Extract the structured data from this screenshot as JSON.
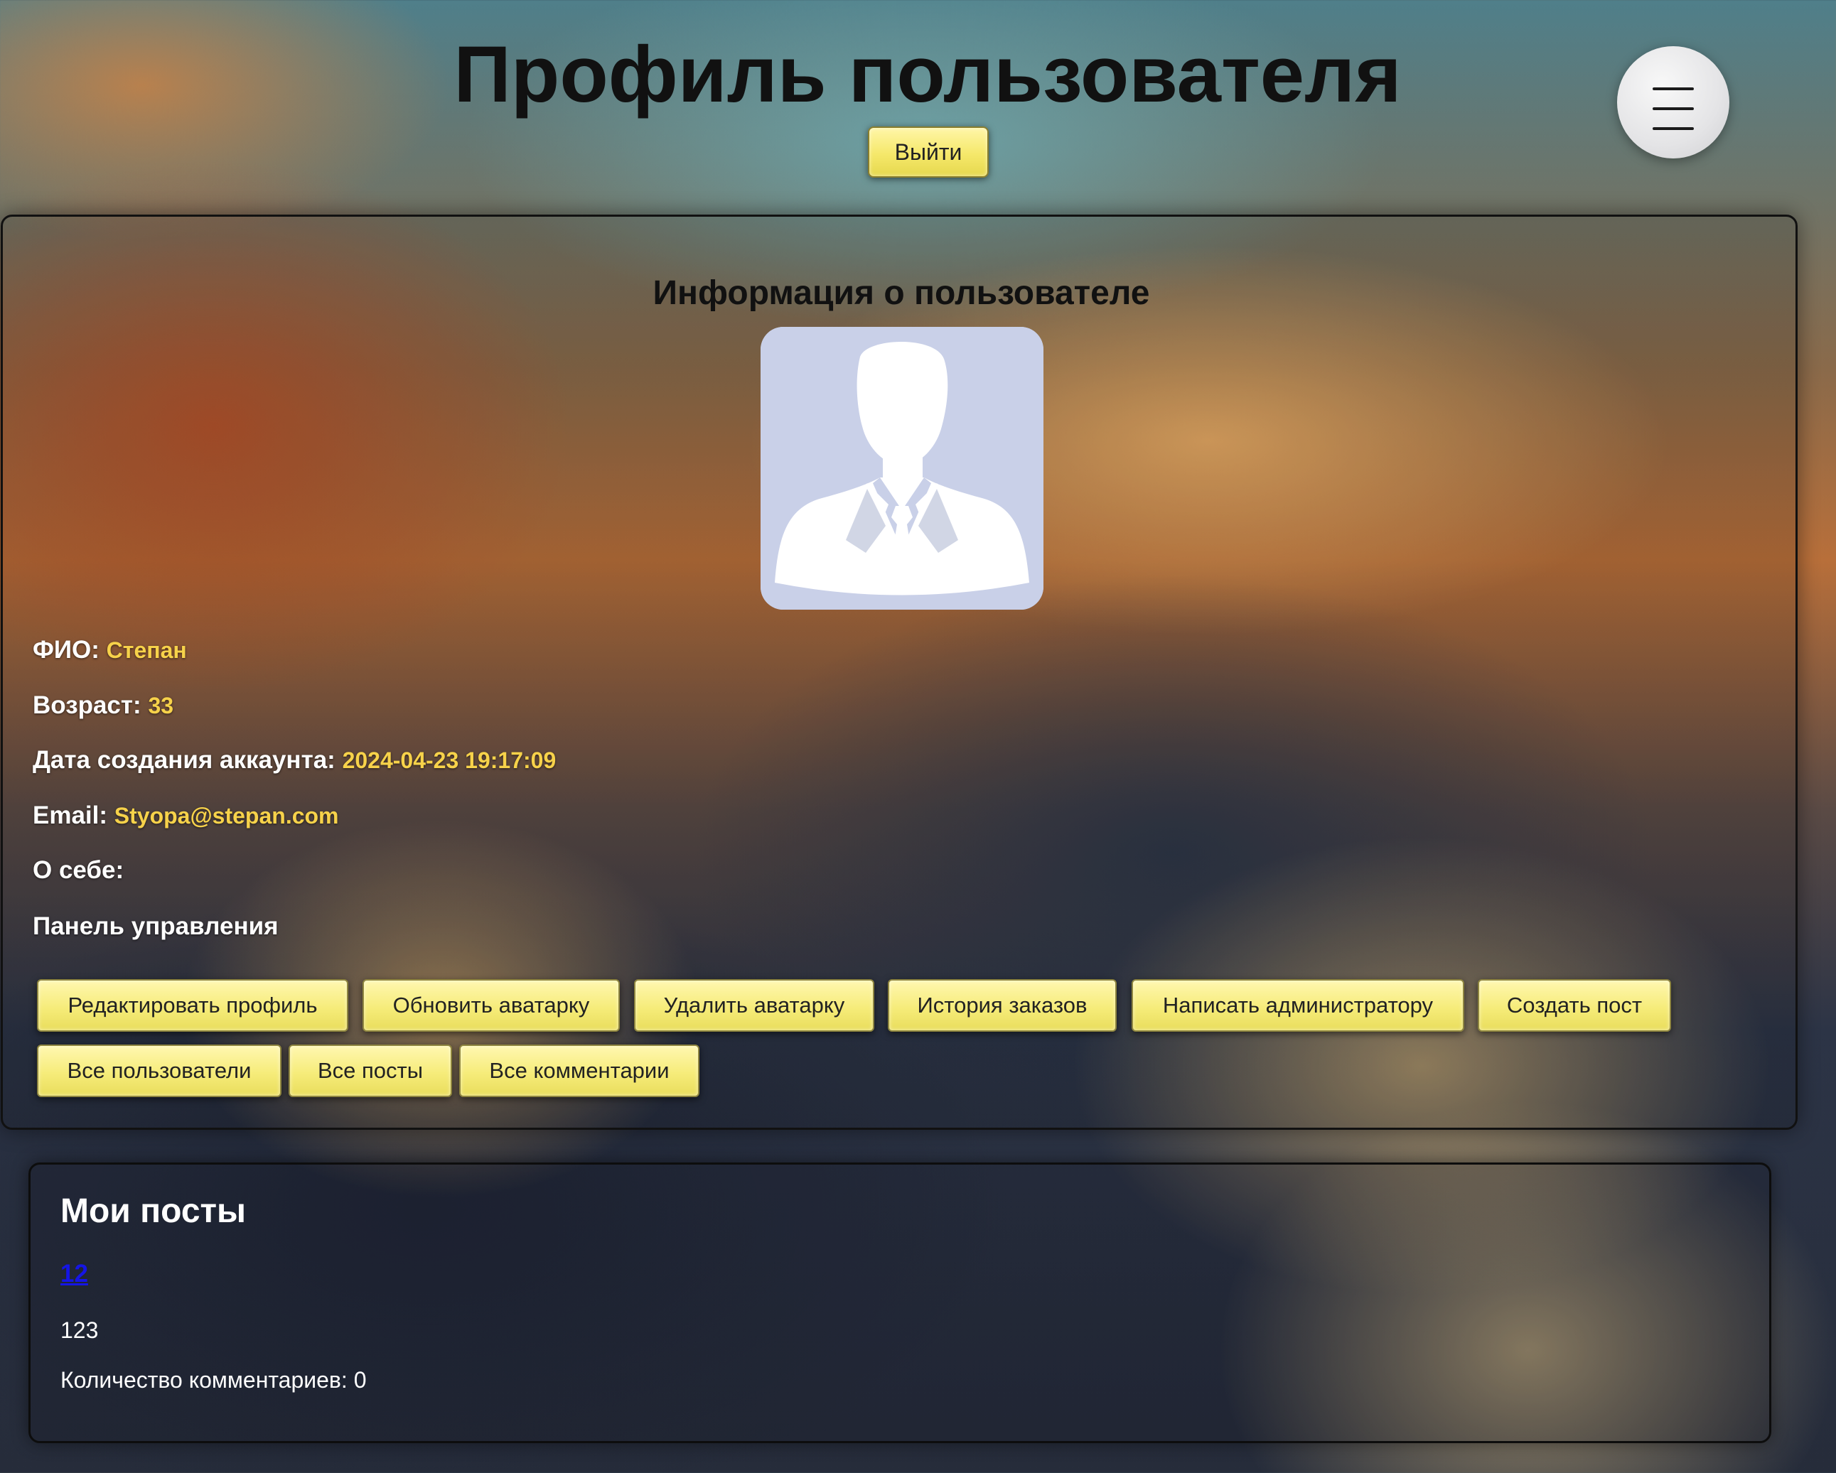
{
  "header": {
    "title": "Профиль пользователя",
    "logout_label": "Выйти",
    "menu_icon": "hamburger-menu-icon"
  },
  "user_info": {
    "heading": "Информация о пользователе",
    "avatar_icon": "default-avatar-icon",
    "fields": {
      "name": {
        "label": "ФИО:",
        "value": "Степан"
      },
      "age": {
        "label": "Возраст:",
        "value": "33"
      },
      "created": {
        "label": "Дата создания аккаунта:",
        "value": "2024-04-23 19:17:09"
      },
      "email": {
        "label": "Email:",
        "value": "Styopa@stepan.com"
      },
      "about": {
        "label": "О себе:",
        "value": ""
      }
    },
    "control_panel_label": "Панель управления"
  },
  "actions": [
    "Редактировать профиль",
    "Обновить аватарку",
    "Удалить аватарку",
    "История заказов",
    "Написать администратору",
    "Создать пост",
    "Все пользователи",
    "Все посты",
    "Все комментарии"
  ],
  "posts": {
    "heading": "Мои посты",
    "items": [
      {
        "title": "12",
        "body": "123",
        "comments_text": "Количество комментариев: 0"
      }
    ]
  },
  "colors": {
    "accent_button": "#f5e86a",
    "value_text": "#f7d24a",
    "link": "#1515e6"
  }
}
